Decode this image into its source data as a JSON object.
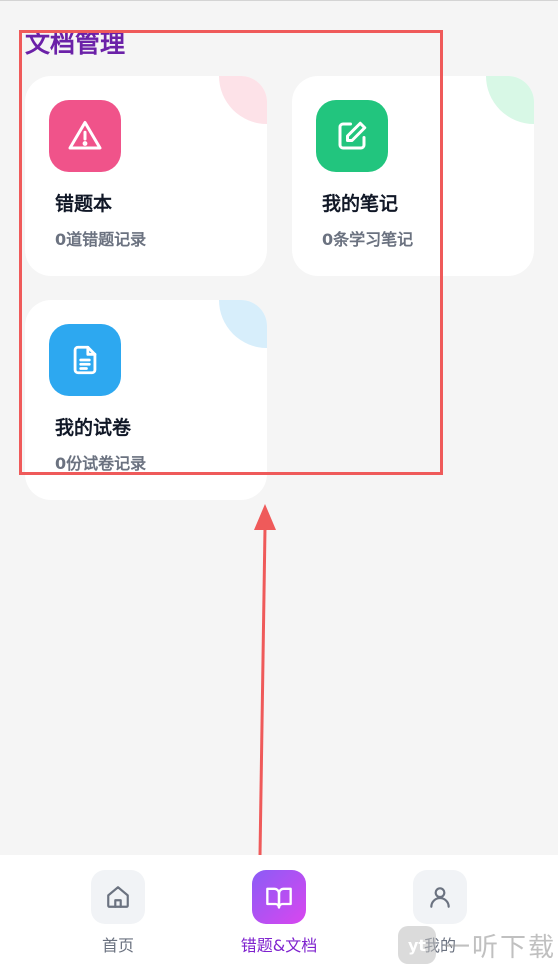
{
  "section": {
    "title": "文档管理"
  },
  "cards": [
    {
      "title": "错题本",
      "subtitle": "0道错题记录",
      "icon": "warning-triangle-icon",
      "color": "#f0538a",
      "corner_color": "#fde2e8"
    },
    {
      "title": "我的笔记",
      "subtitle": "0条学习笔记",
      "icon": "edit-note-icon",
      "color": "#22c57e",
      "corner_color": "#d8f8e6"
    },
    {
      "title": "我的试卷",
      "subtitle": "0份试卷记录",
      "icon": "document-icon",
      "color": "#2da8f0",
      "corner_color": "#d7eefb"
    }
  ],
  "nav": {
    "items": [
      {
        "label": "首页",
        "icon": "home-icon",
        "active": false
      },
      {
        "label": "错题&文档",
        "icon": "book-open-icon",
        "active": true
      },
      {
        "label": "我的",
        "icon": "user-icon",
        "active": false
      }
    ]
  },
  "watermark": {
    "logo_text": "yt",
    "text": "一听下载"
  },
  "colors": {
    "accent": "#7e22ce",
    "title": "#6b21a8",
    "highlight_box": "#ef5a5a",
    "nav_active_gradient": [
      "#8b5cf6",
      "#d946ef"
    ]
  }
}
